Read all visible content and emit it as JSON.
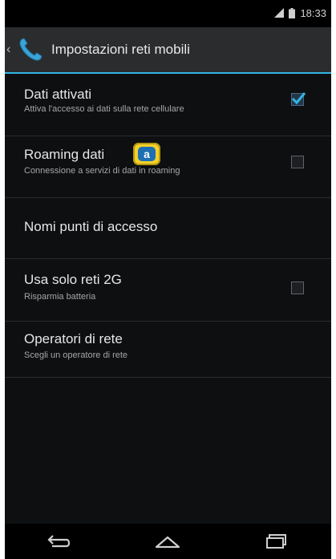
{
  "status_bar": {
    "time": "18:33",
    "icons": [
      "signal-icon",
      "battery-icon"
    ]
  },
  "action_bar": {
    "icon": "phone-icon",
    "title": "Impostazioni reti mobili"
  },
  "settings": {
    "items": [
      {
        "title": "Dati attivati",
        "subtitle": "Attiva l'accesso ai dati sulla rete cellulare",
        "checkbox": true,
        "checked": true
      },
      {
        "title": "Roaming dati",
        "subtitle": "Connessione a servizi di dati in roaming",
        "checkbox": true,
        "checked": false
      },
      {
        "title": "Nomi punti di accesso",
        "subtitle": "",
        "checkbox": false
      },
      {
        "title": "Usa solo reti 2G",
        "subtitle": "Risparmia batteria",
        "checkbox": true,
        "checked": false
      },
      {
        "title": "Operatori di rete",
        "subtitle": "Scegli un operatore di rete",
        "checkbox": false
      }
    ]
  },
  "callout": {
    "label": "a"
  },
  "nav_bar": {
    "buttons": [
      "back-icon",
      "home-icon",
      "recents-icon"
    ]
  },
  "colors": {
    "accent": "#33b5e5",
    "callout_fill": "#f5d02a",
    "callout_inner": "#1d6fb3"
  }
}
